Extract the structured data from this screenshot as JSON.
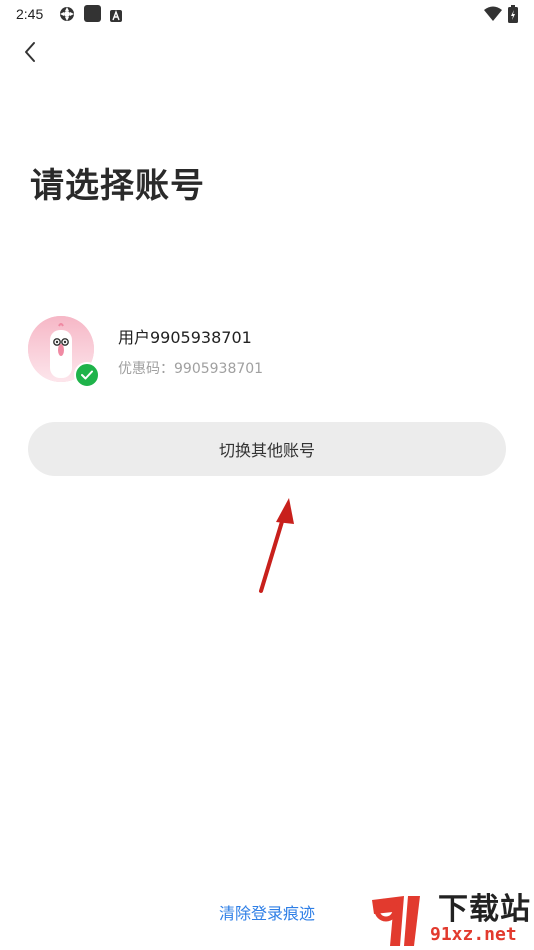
{
  "status_bar": {
    "time": "2:45",
    "icons": [
      "settings-icon",
      "stop-icon",
      "font-icon",
      "wifi-icon",
      "battery-icon"
    ]
  },
  "nav": {
    "back_icon": "chevron-left-icon"
  },
  "page": {
    "title": "请选择账号"
  },
  "account": {
    "name": "用户9905938701",
    "code": "优惠码：9905938701",
    "verified_color": "#1fb34a"
  },
  "switch_button": {
    "label": "切换其他账号"
  },
  "footer": {
    "clear_link": "清除登录痕迹",
    "link_color": "#2f7fe6"
  },
  "watermark": {
    "brand_top": "下载站",
    "brand_bottom": "91xz.net",
    "logo_mark": "9",
    "accent": "#e23a2e"
  }
}
